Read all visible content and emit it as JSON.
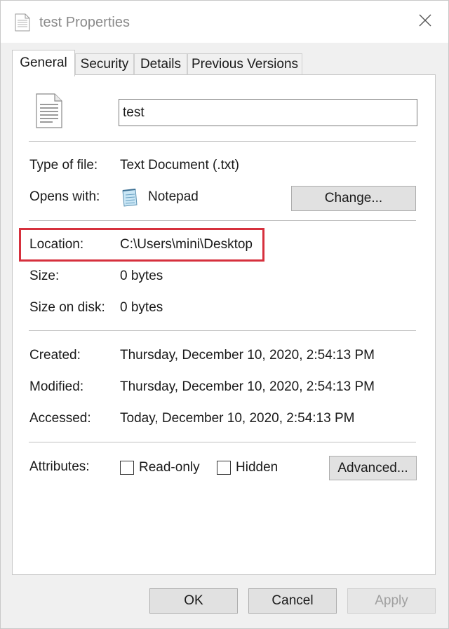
{
  "window": {
    "title": "test Properties",
    "icon": "text-document-icon",
    "close_icon": "close-icon"
  },
  "tabs": [
    {
      "label": "General",
      "active": true
    },
    {
      "label": "Security",
      "active": false
    },
    {
      "label": "Details",
      "active": false
    },
    {
      "label": "Previous Versions",
      "active": false
    }
  ],
  "general": {
    "file_name": "test",
    "type_label": "Type of file:",
    "type_value": "Text Document (.txt)",
    "opens_label": "Opens with:",
    "opens_value": "Notepad",
    "change_button": "Change...",
    "location_label": "Location:",
    "location_value": "C:\\Users\\mini\\Desktop",
    "size_label": "Size:",
    "size_value": "0 bytes",
    "size_on_disk_label": "Size on disk:",
    "size_on_disk_value": "0 bytes",
    "created_label": "Created:",
    "created_value": "Thursday, December 10, 2020, 2:54:13 PM",
    "modified_label": "Modified:",
    "modified_value": "Thursday, December 10, 2020, 2:54:13 PM",
    "accessed_label": "Accessed:",
    "accessed_value": "Today, December 10, 2020, 2:54:13 PM",
    "attributes_label": "Attributes:",
    "readonly_label": "Read-only",
    "readonly_checked": false,
    "hidden_label": "Hidden",
    "hidden_checked": false,
    "advanced_button": "Advanced..."
  },
  "footer": {
    "ok": "OK",
    "cancel": "Cancel",
    "apply": "Apply"
  },
  "colors": {
    "highlight_box": "#d6303d",
    "dialog_bg": "#f0f0f0",
    "button_bg": "#e1e1e1"
  }
}
